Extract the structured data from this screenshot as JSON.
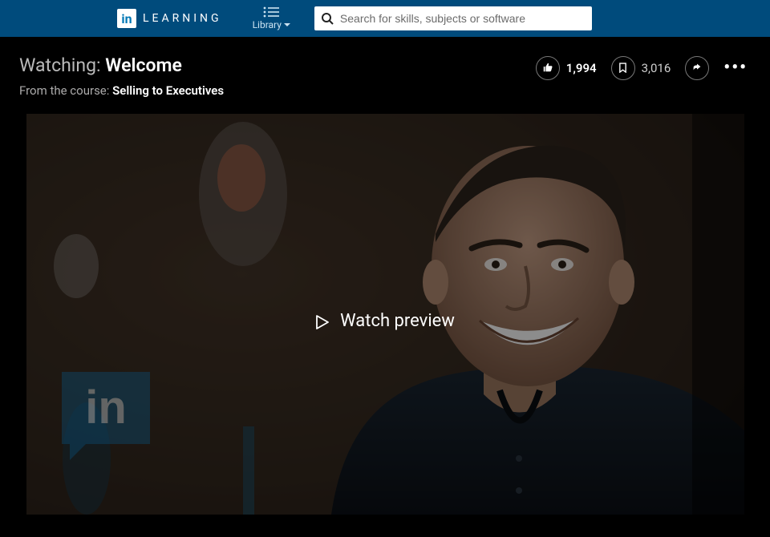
{
  "header": {
    "logo_tile": "in",
    "logo_text": "LEARNING",
    "library_label": "Library",
    "search_placeholder": "Search for skills, subjects or software"
  },
  "title": {
    "watching_prefix": "Watching: ",
    "video_title": "Welcome",
    "from_course_prefix": "From the course: ",
    "course_name": "Selling to Executives"
  },
  "actions": {
    "likes": "1,994",
    "saves": "3,016"
  },
  "video": {
    "preview_label": "Watch preview",
    "watermark_text": "in"
  },
  "colors": {
    "header_bg": "#004b7c",
    "linkedin_blue": "#0077b5"
  }
}
